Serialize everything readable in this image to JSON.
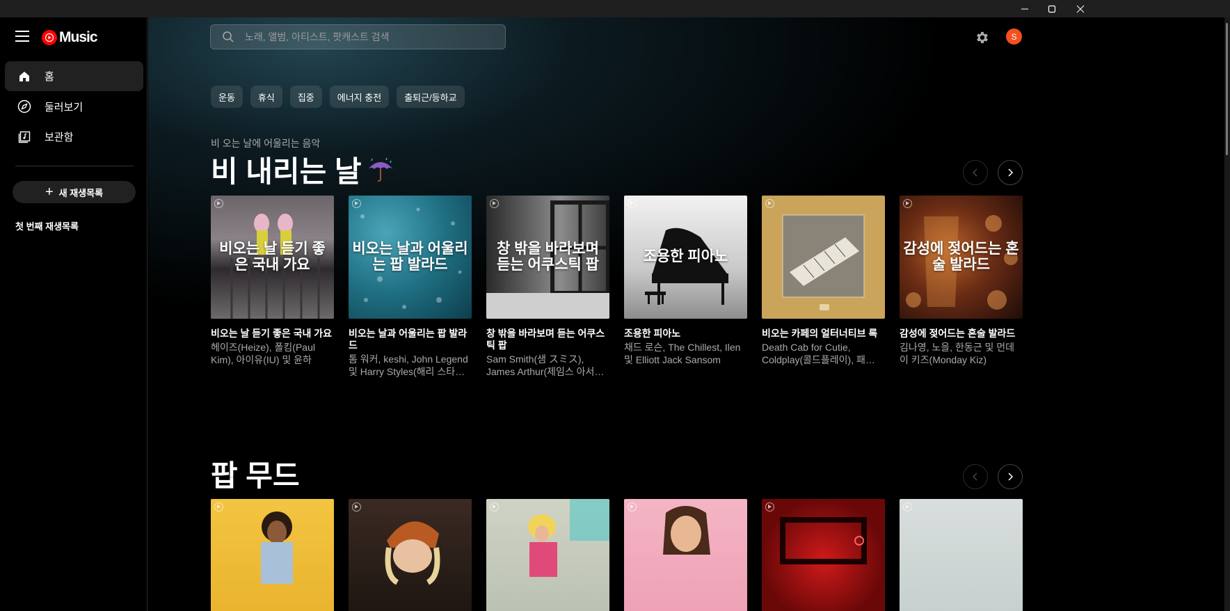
{
  "window": {
    "minimize": "minimize-icon",
    "maximize": "maximize-icon",
    "close": "close-icon"
  },
  "sidebar": {
    "logo_text": "Music",
    "items": [
      {
        "label": "홈",
        "icon": "home-icon",
        "active": true
      },
      {
        "label": "둘러보기",
        "icon": "compass-icon",
        "active": false
      },
      {
        "label": "보관함",
        "icon": "library-icon",
        "active": false
      }
    ],
    "new_playlist_label": "새 재생목록",
    "playlists": [
      "첫 번째 재생목록"
    ]
  },
  "header": {
    "search_placeholder": "노래, 앨범, 아티스트, 팟캐스트 검색",
    "avatar_letter": "S"
  },
  "chips": [
    "운동",
    "휴식",
    "집중",
    "에너지 충전",
    "출퇴근/등하교"
  ],
  "sections": [
    {
      "subtitle": "비 오는 날에 어울리는 음악",
      "title": "비 내리는 날",
      "cards": [
        {
          "overlay": "비오는 날 듣기 좋은 국내 가요",
          "title": "비오는 날 듣기 좋은 국내 가요",
          "subtitle": "헤이즈(Heize), 폴킴(Paul Kim), 아이유(IU) 및 윤하"
        },
        {
          "overlay": "비오는 날과 어울리는 팝 발라드",
          "title": "비오는 날과 어울리는 팝 발라드",
          "subtitle": "톰 워커, keshi, John Legend 및 Harry Styles(해리 스타…"
        },
        {
          "overlay": "창 밖을 바라보며 듣는 어쿠스틱 팝",
          "title": "창 밖을 바라보며 듣는 어쿠스틱 팝",
          "subtitle": "Sam Smith(샘 スミス), James Arthur(제임스 아서…"
        },
        {
          "overlay": "조용한 피아노",
          "title": "조용한 피아노",
          "subtitle": "채드 로슨, The Chillest, Ilen 및 Elliott Jack Sansom"
        },
        {
          "overlay": "",
          "title": "비오는 카페의 얼터너티브 록",
          "subtitle": "Death Cab for Cutie, Coldplay(콜드플레이), 패…"
        },
        {
          "overlay": "감성에 젖어드는 혼술 발라드",
          "title": "감성에 젖어드는 혼술 발라드",
          "subtitle": "김나영, 노을, 한동근 및 먼데이 키즈(Monday Kiz)"
        }
      ]
    },
    {
      "subtitle": "",
      "title": "팝 무드",
      "cards": [
        {
          "overlay": "",
          "title": "",
          "subtitle": ""
        },
        {
          "overlay": "",
          "title": "",
          "subtitle": ""
        },
        {
          "overlay": "",
          "title": "",
          "subtitle": ""
        },
        {
          "overlay": "",
          "title": "",
          "subtitle": ""
        },
        {
          "overlay": "",
          "title": "",
          "subtitle": ""
        },
        {
          "overlay": "",
          "title": "",
          "subtitle": ""
        }
      ]
    }
  ],
  "colors": {
    "accent": "#ff0000",
    "avatar": "#f4511e",
    "chip_bg": "#2a3538"
  }
}
